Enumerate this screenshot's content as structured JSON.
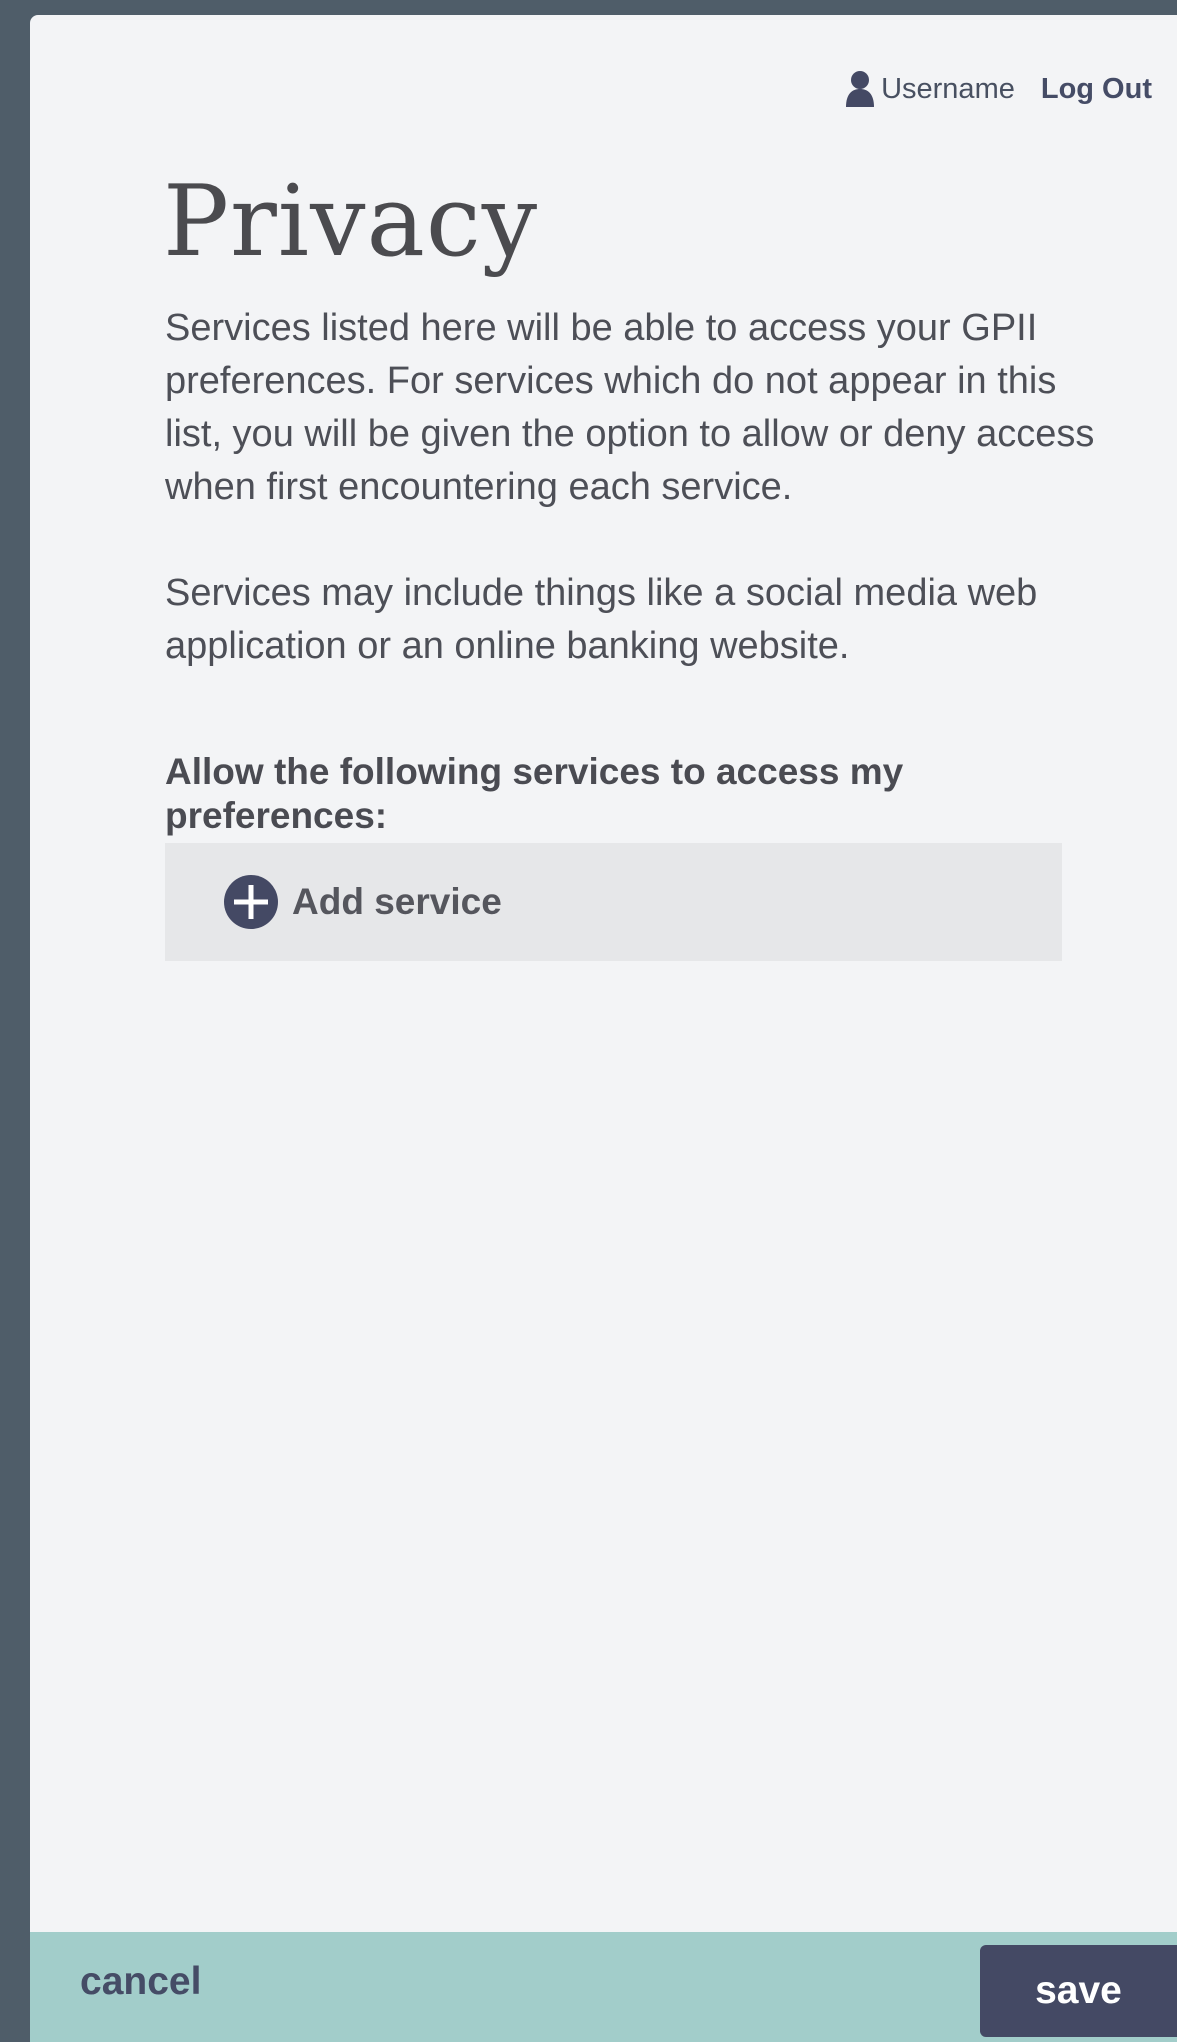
{
  "header": {
    "username": "Username",
    "logout_label": "Log Out"
  },
  "main": {
    "title": "Privacy",
    "intro_paragraph_1": "Services listed here will be able to access your GPII preferences. For services which do not appear in this list, you will be given the option to allow or deny access when first encountering each service.",
    "intro_paragraph_2": "Services may include things like a social media web application or an online banking website.",
    "allow_heading": "Allow the following services to access my preferences:",
    "add_service_label": "Add service"
  },
  "footer": {
    "cancel_label": "cancel",
    "save_label": "save"
  },
  "icons": {
    "user": "user-icon",
    "add": "plus-circle-icon"
  },
  "colors": {
    "background": "#4f5d69",
    "panel": "#f3f4f6",
    "accent_dark": "#444964",
    "footer": "#a2cdca",
    "add_service_bg": "#e6e7e9"
  }
}
